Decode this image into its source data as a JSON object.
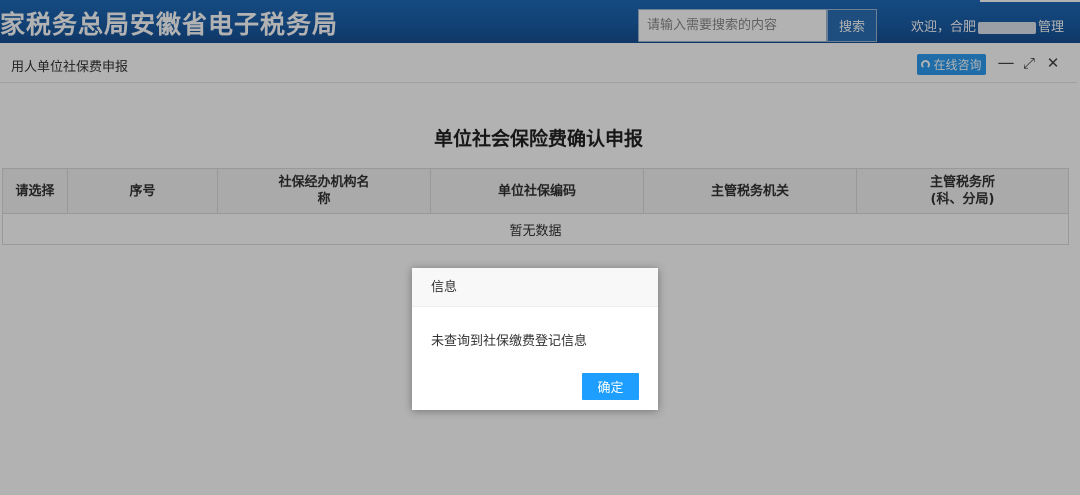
{
  "banner": {
    "title": "家税务总局安徽省电子税务局",
    "search_placeholder": "请输入需要搜索的内容",
    "search_button": "搜索",
    "welcome_prefix": "欢迎，合肥",
    "welcome_suffix": "管理",
    "colors": {
      "banner_bg": "#1a5ea9",
      "search_button_bg": "#2c6fb8"
    }
  },
  "window": {
    "title": "用人单位社保费申报",
    "consult_button": "在线咨询",
    "controls": [
      "minimize-icon",
      "restore-icon",
      "close-icon"
    ],
    "minimize_glyph": "—",
    "restore_glyph": "⤢",
    "close_glyph": "✕",
    "consult_color": "#2d9cf1"
  },
  "main": {
    "page_title": "单位社会保险费确认申报",
    "table": {
      "columns": [
        {
          "label": "请选择"
        },
        {
          "label": "序号"
        },
        {
          "label": "社保经办机构名",
          "label2": "称"
        },
        {
          "label": "单位社保编码"
        },
        {
          "label": "主管税务机关"
        },
        {
          "label": "主管税务所",
          "label2": "(科、分局)"
        }
      ],
      "empty_text": "暂无数据"
    }
  },
  "dialog": {
    "title": "信息",
    "message": "未查询到社保缴费登记信息",
    "ok_button": "确定",
    "ok_color": "#1e9fff"
  }
}
